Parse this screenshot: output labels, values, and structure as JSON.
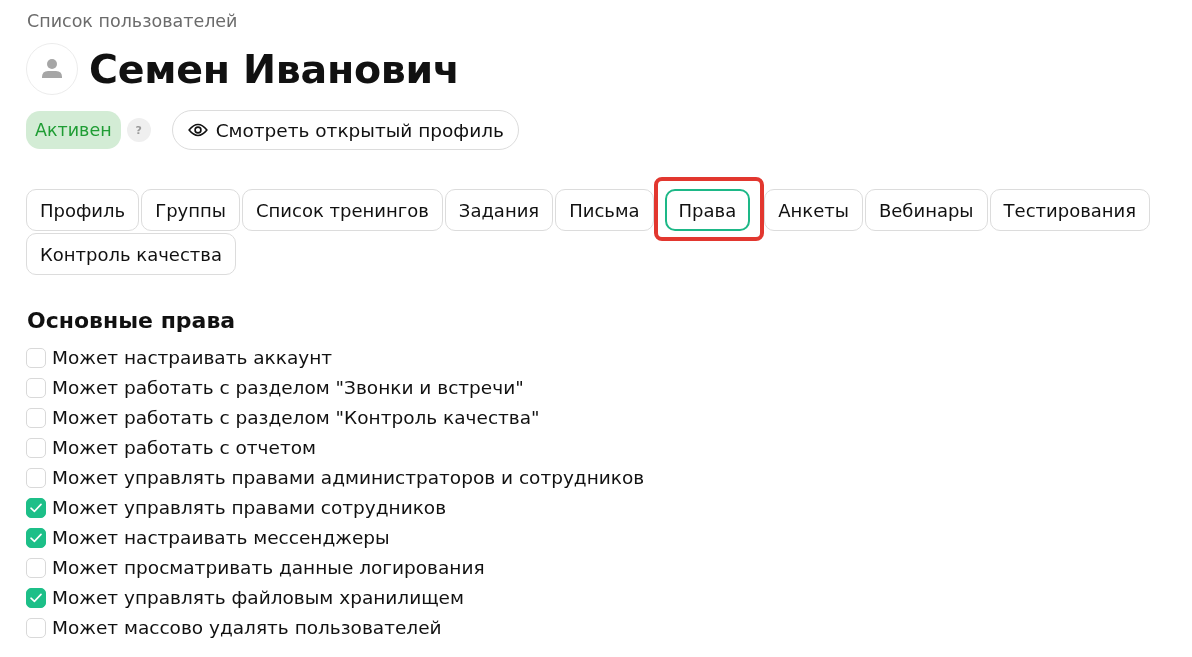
{
  "breadcrumb": "Список пользователей",
  "user": {
    "name": "Семен Иванович"
  },
  "status": {
    "label": "Активен",
    "kind": "active",
    "help": "?"
  },
  "view_profile_button": "Смотреть открытый профиль",
  "tabs": [
    {
      "label": "Профиль",
      "selected": false,
      "highlighted": false
    },
    {
      "label": "Группы",
      "selected": false,
      "highlighted": false
    },
    {
      "label": "Список тренингов",
      "selected": false,
      "highlighted": false
    },
    {
      "label": "Задания",
      "selected": false,
      "highlighted": false
    },
    {
      "label": "Письма",
      "selected": false,
      "highlighted": false
    },
    {
      "label": "Права",
      "selected": true,
      "highlighted": true
    },
    {
      "label": "Анкеты",
      "selected": false,
      "highlighted": false
    },
    {
      "label": "Вебинары",
      "selected": false,
      "highlighted": false
    },
    {
      "label": "Тестирования",
      "selected": false,
      "highlighted": false
    },
    {
      "label": "Контроль качества",
      "selected": false,
      "highlighted": false
    }
  ],
  "section": {
    "title": "Основные права",
    "permissions": [
      {
        "label": "Может настраивать аккаунт",
        "checked": false
      },
      {
        "label": "Может работать с разделом \"Звонки и встречи\"",
        "checked": false
      },
      {
        "label": "Может работать с разделом \"Контроль качества\"",
        "checked": false
      },
      {
        "label": "Может работать с отчетом",
        "checked": false
      },
      {
        "label": "Может управлять правами администраторов и сотрудников",
        "checked": false
      },
      {
        "label": "Может управлять правами сотрудников",
        "checked": true
      },
      {
        "label": "Может настраивать мессенджеры",
        "checked": true
      },
      {
        "label": "Может просматривать данные логирования",
        "checked": false
      },
      {
        "label": "Может управлять файловым хранилищем",
        "checked": true
      },
      {
        "label": "Может массово удалять пользователей",
        "checked": false
      }
    ]
  }
}
